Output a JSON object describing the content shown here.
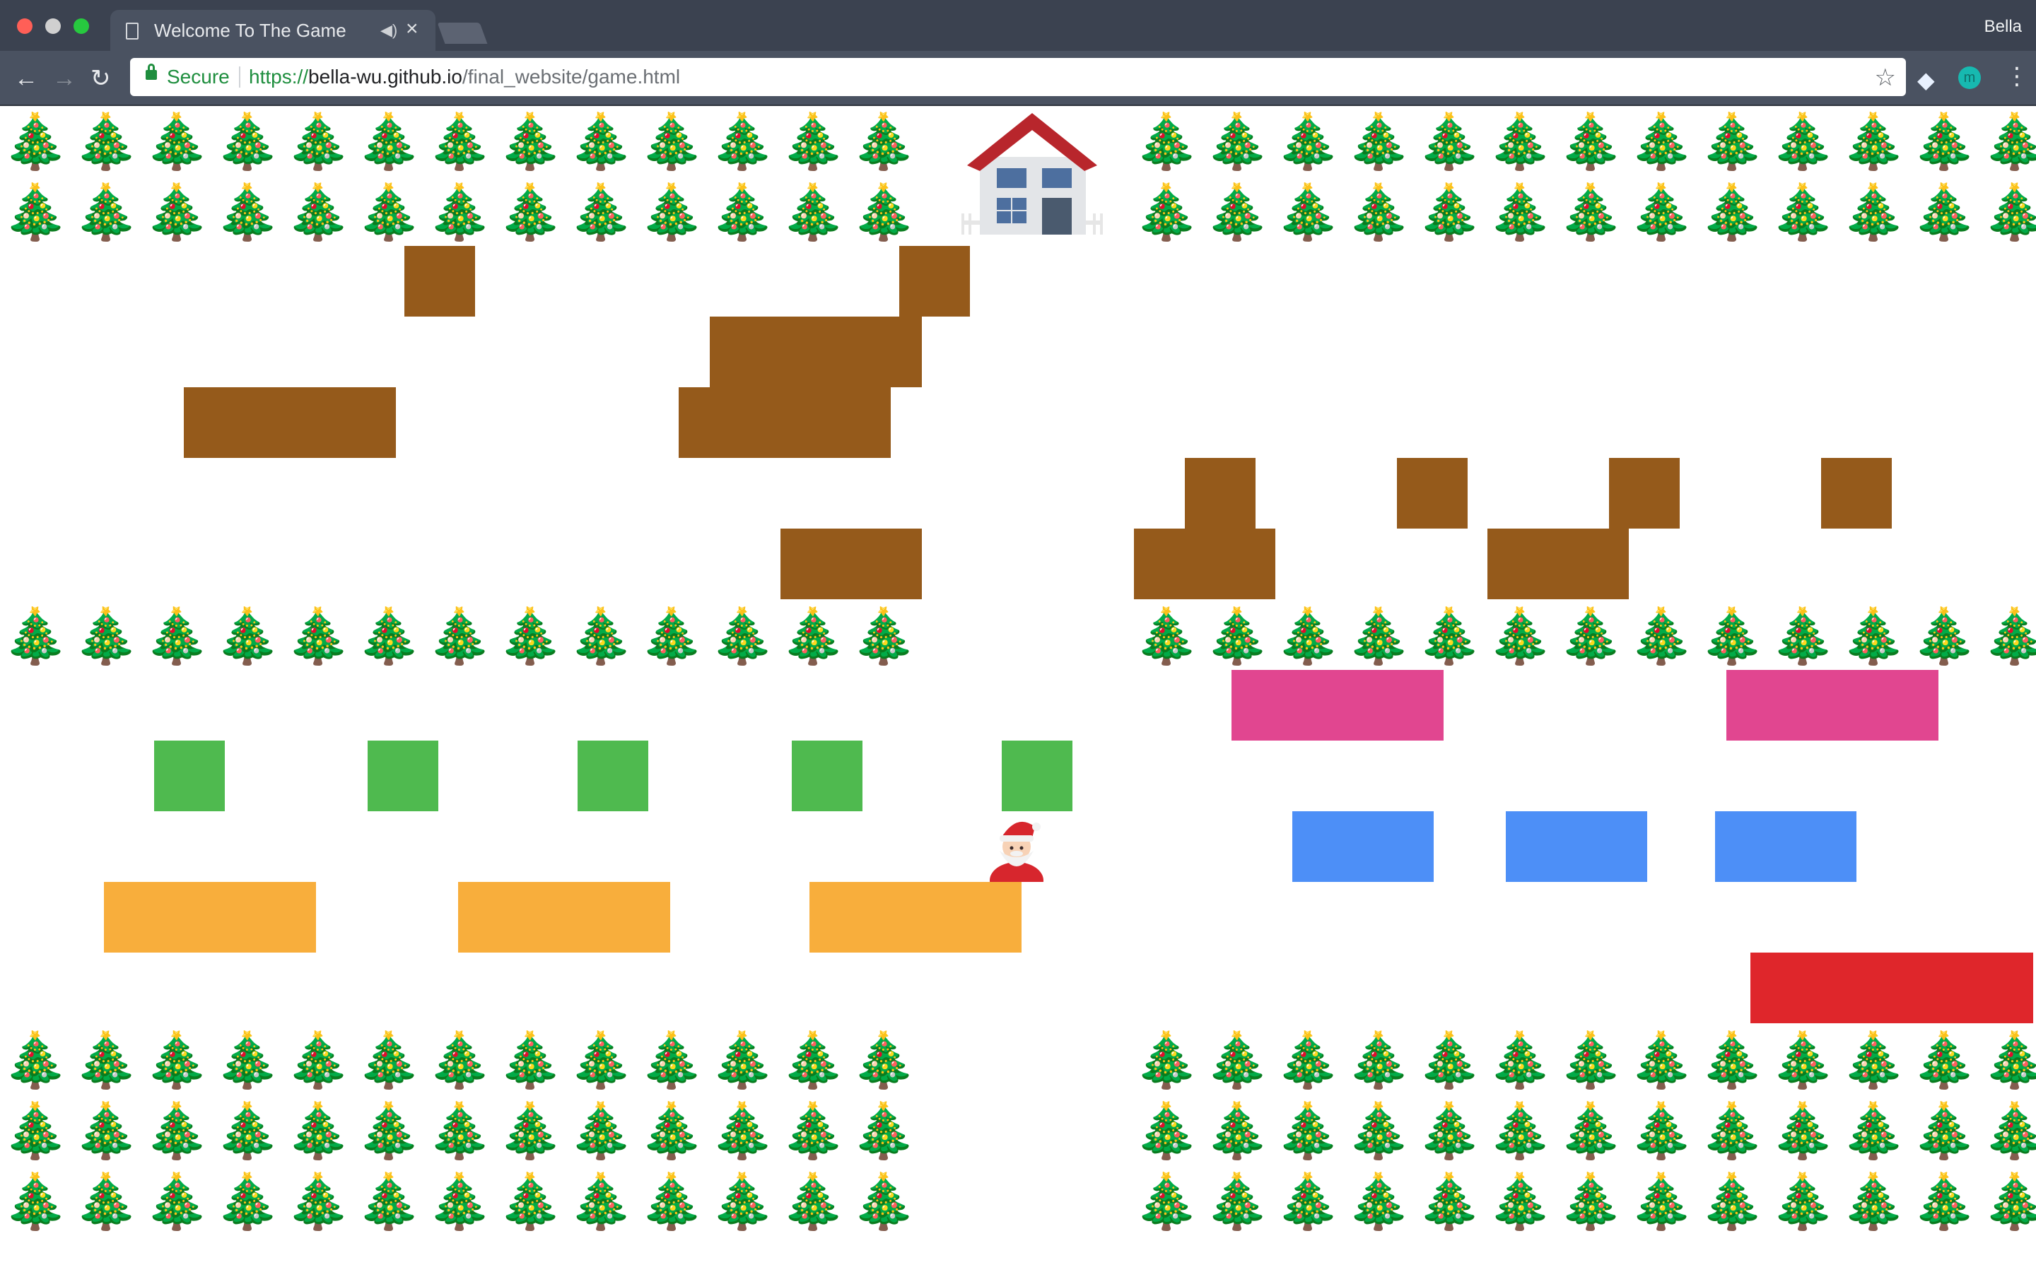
{
  "window": {
    "traffic_lights": [
      "#ff5f57",
      "#d0d0d0",
      "#27c93f"
    ],
    "profile_name": "Bella"
  },
  "tab": {
    "title": "Welcome To The Game",
    "audio_icon": "speaker-icon",
    "close_label": "×"
  },
  "toolbar": {
    "back_icon": "←",
    "forward_icon": "→",
    "reload_icon": "↻",
    "secure_label": "Secure",
    "url_scheme": "https://",
    "url_host": "bella-wu.github.io",
    "url_path": "/final_website/game.html",
    "bookmark_icon": "☆",
    "extension_icon": "m",
    "menu_icon": "⋮"
  },
  "game": {
    "tree_glyph": "🎄",
    "goal": "house-icon",
    "player": "santa-icon",
    "colors": {
      "brown": "#955a1b",
      "green": "#4fba4f",
      "orange": "#f8ae3c",
      "pink": "#e14690",
      "blue": "#4d8ff7",
      "red": "#df262b"
    }
  }
}
